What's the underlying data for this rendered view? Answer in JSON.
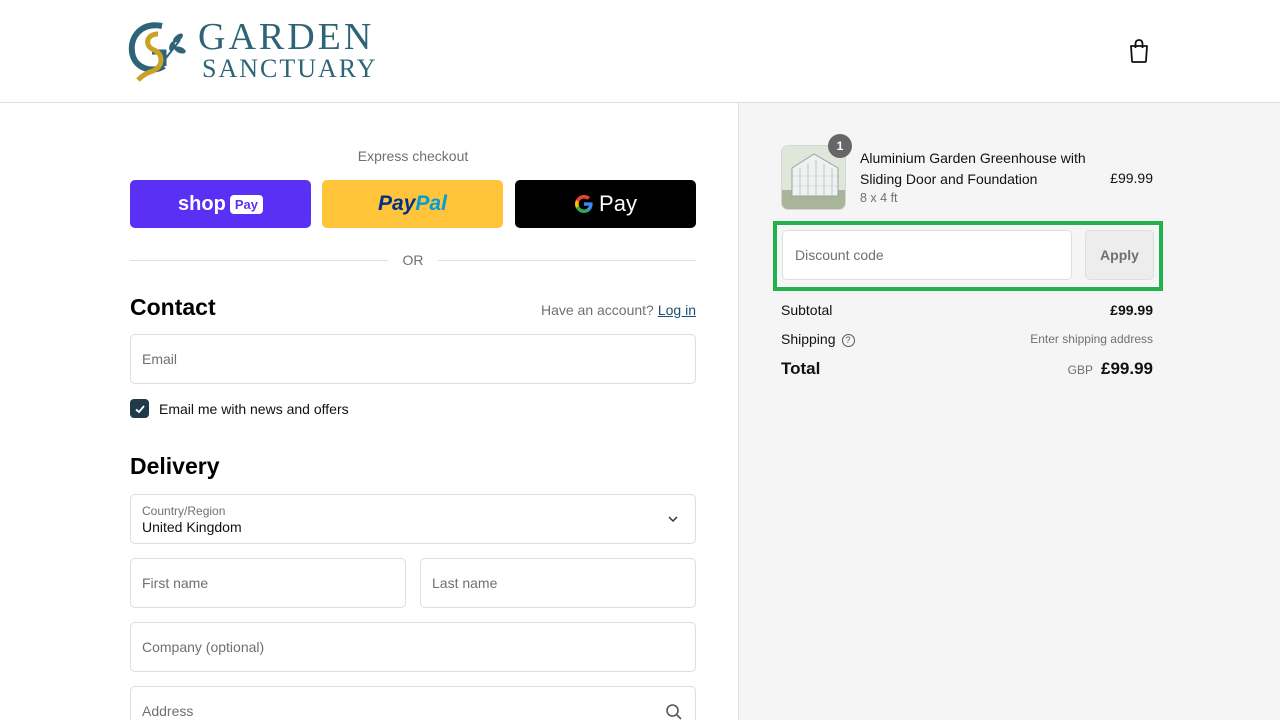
{
  "brand": {
    "line1": "GARDEN",
    "line2": "SANCTUARY",
    "colors": {
      "teal": "#2e6478",
      "gold": "#c9a227"
    }
  },
  "header": {
    "cart_icon": "shopping-bag-icon"
  },
  "express": {
    "label": "Express checkout",
    "shop": {
      "text": "shop",
      "tag": "Pay"
    },
    "paypal": {
      "part1": "Pay",
      "part2": "Pal"
    },
    "gpay": {
      "g": "G",
      "text": "Pay"
    },
    "or": "OR"
  },
  "contact": {
    "heading": "Contact",
    "have_account": "Have an account?",
    "login": "Log in",
    "email_placeholder": "Email",
    "news_label": "Email me with news and offers",
    "news_checked": true
  },
  "delivery": {
    "heading": "Delivery",
    "country_label": "Country/Region",
    "country_value": "United Kingdom",
    "first_name": "First name",
    "last_name": "Last name",
    "company": "Company (optional)",
    "address": "Address"
  },
  "summary": {
    "product": {
      "qty": "1",
      "name": "Aluminium Garden Greenhouse with Sliding Door and Foundation",
      "variant": "8 x 4 ft",
      "price": "£99.99"
    },
    "discount_placeholder": "Discount code",
    "apply": "Apply",
    "subtotal_label": "Subtotal",
    "subtotal_value": "£99.99",
    "shipping_label": "Shipping",
    "shipping_value": "Enter shipping address",
    "total_label": "Total",
    "currency": "GBP",
    "total_value": "£99.99"
  },
  "colors": {
    "shop_pay": "#5a31f4",
    "paypal": "#ffc439",
    "gpay": "#000000",
    "highlight": "#22b14c"
  }
}
